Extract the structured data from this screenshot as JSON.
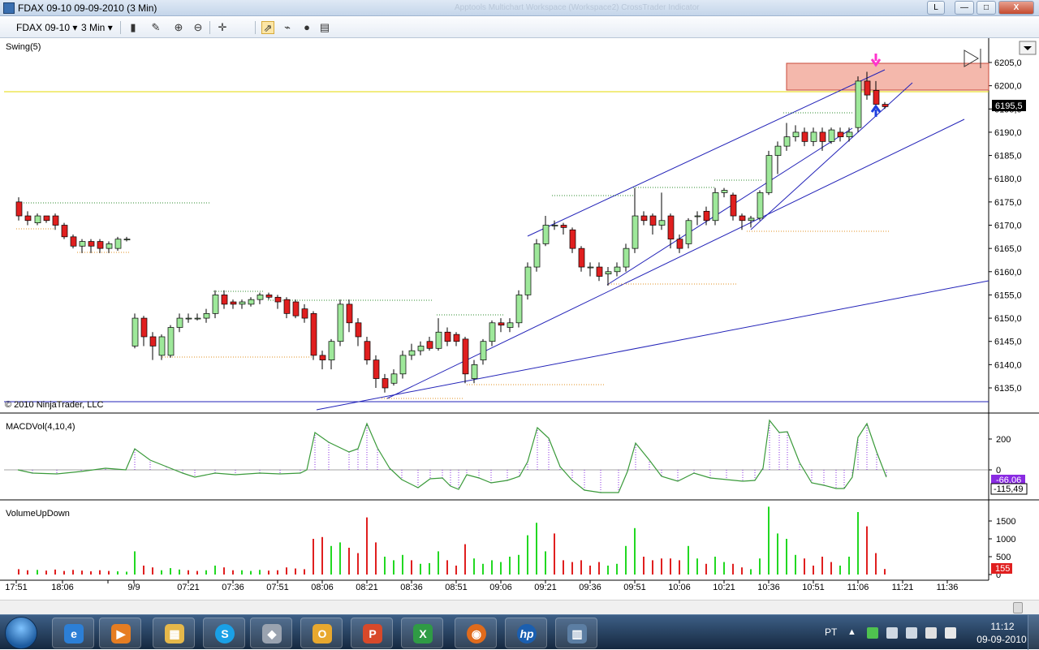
{
  "window": {
    "title": "FDAX 09-10  09-09-2010 (3 Min)",
    "ghost_title": "Apptools  Multichart  Workspace (Workspace2)  CrossTrader Indicator",
    "buttons": {
      "mode": "L",
      "min": "—",
      "max": "□",
      "close": "X"
    }
  },
  "toolbar": {
    "instrument": "FDAX 09-10",
    "interval": "3 Min",
    "dropdown": "▾"
  },
  "price_panel": {
    "label": "Swing(5)",
    "copyright": "© 2010 NinjaTrader, LLC",
    "last_price": "6195,5",
    "y_ticks": [
      "6205,0",
      "6200,0",
      "6195,0",
      "6190,0",
      "6185,0",
      "6180,0",
      "6175,0",
      "6170,0",
      "6165,0",
      "6160,0",
      "6155,0",
      "6150,0",
      "6145,0",
      "6140,0",
      "6135,0"
    ],
    "y_tick_values": [
      6205,
      6200,
      6195,
      6190,
      6185,
      6180,
      6175,
      6170,
      6165,
      6160,
      6155,
      6150,
      6145,
      6140,
      6135
    ]
  },
  "macd_panel": {
    "label": "MACDVol(4,10,4)",
    "y_ticks": [
      "200",
      "0"
    ],
    "value_1": "-66,06",
    "value_2": "-115,49"
  },
  "volume_panel": {
    "label": "VolumeUpDown",
    "y_ticks": [
      "1500",
      "1000",
      "500",
      "0"
    ],
    "last_value": "155"
  },
  "time_axis": {
    "labels": [
      "17:51",
      "18:06",
      "9/9",
      "07:21",
      "07:36",
      "07:51",
      "08:06",
      "08:21",
      "08:36",
      "08:51",
      "09:06",
      "09:21",
      "09:36",
      "09:51",
      "10:06",
      "10:21",
      "10:36",
      "10:51",
      "11:06",
      "11:21",
      "11:36"
    ]
  },
  "colors": {
    "up": "#9ee89a",
    "down": "#e01f1f",
    "trendline": "#2323b8",
    "zone": "#f4b8ac",
    "hline": "#e6d800",
    "macd": "#3a9a3a",
    "macd_hist": "#8a2be2",
    "vol_up": "#22d822",
    "vol_down": "#e01f1f"
  },
  "taskbar": {
    "tray_lang": "PT",
    "time": "11:12",
    "date": "09-09-2010"
  }
}
